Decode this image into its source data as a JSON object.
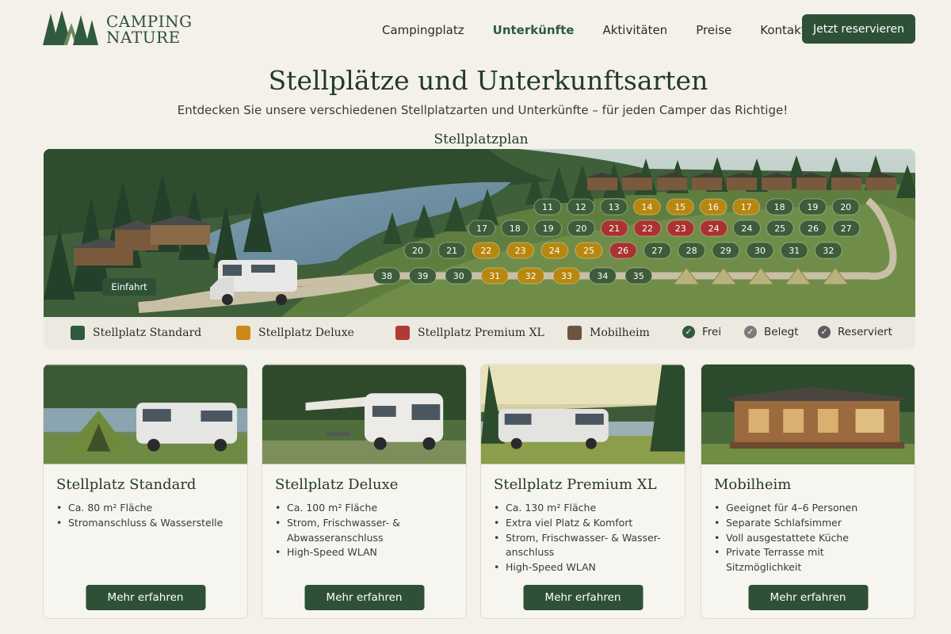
{
  "logo": {
    "line1": "CAMPING",
    "line2": "NATURE"
  },
  "nav": {
    "items": [
      {
        "label": "Campingplatz",
        "active": false
      },
      {
        "label": "Unterkünfte",
        "active": true
      },
      {
        "label": "Aktivitäten",
        "active": false
      },
      {
        "label": "Preise",
        "active": false
      },
      {
        "label": "Kontakt",
        "active": false
      }
    ],
    "cta": "Jetzt reservieren"
  },
  "hero": {
    "title": "Stellplätze und Unterkunftsarten",
    "subtitle": "Entdecken Sie unsere verschiedenen Stellplatzarten und Unterkünfte – für jeden Camper das Richtige!"
  },
  "plan": {
    "title": "Stellplatzplan",
    "entrance_label": "Einfahrt",
    "rows": [
      [
        "11",
        "12",
        "13",
        "14",
        "15",
        "16",
        "17",
        "18",
        "19",
        "20"
      ],
      [
        "17",
        "18",
        "19",
        "20",
        "21",
        "22",
        "23",
        "24",
        "24",
        "25",
        "26",
        "27"
      ],
      [
        "20",
        "21",
        "22",
        "23",
        "24",
        "25",
        "26",
        "27",
        "28",
        "29",
        "30",
        "31",
        "32"
      ],
      [
        "38",
        "39",
        "30",
        "31",
        "32",
        "33",
        "34",
        "35"
      ]
    ],
    "row_types": [
      [
        "standard",
        "standard",
        "standard",
        "deluxe",
        "deluxe",
        "deluxe",
        "deluxe",
        "standard",
        "standard",
        "standard"
      ],
      [
        "standard",
        "standard",
        "standard",
        "standard",
        "premium",
        "premium",
        "premium",
        "premium",
        "standard",
        "standard",
        "standard",
        "standard"
      ],
      [
        "standard",
        "standard",
        "deluxe",
        "deluxe",
        "deluxe",
        "deluxe",
        "premium",
        "standard",
        "standard",
        "standard",
        "standard",
        "standard",
        "standard"
      ],
      [
        "standard",
        "standard",
        "standard",
        "deluxe",
        "deluxe",
        "deluxe",
        "standard",
        "standard"
      ]
    ]
  },
  "legend": {
    "items": [
      {
        "label": "Stellplatz Standard",
        "color": "#2f5a3b"
      },
      {
        "label": "Stellplatz Deluxe",
        "color": "#c98a17"
      },
      {
        "label": "Stellplatz Premium XL",
        "color": "#b23a36"
      },
      {
        "label": "Mobilheim",
        "color": "#6b5540"
      }
    ],
    "status": [
      {
        "label": "Frei",
        "color": "#2f5a3b"
      },
      {
        "label": "Belegt",
        "color": "#7c7c7c"
      },
      {
        "label": "Reserviert",
        "color": "#5c5c5c"
      }
    ]
  },
  "cards": [
    {
      "title": "Stellplatz Standard",
      "features": [
        "Ca. 80 m² Fläche",
        "Stromanschluss & Wasserstelle"
      ],
      "button": "Mehr erfahren"
    },
    {
      "title": "Stellplatz Deluxe",
      "features": [
        "Ca. 100 m² Fläche",
        "Strom, Frischwasser- & Abwasseranschluss",
        "High-Speed WLAN"
      ],
      "button": "Mehr erfahren"
    },
    {
      "title": "Stellplatz Premium XL",
      "features": [
        "Ca. 130 m² Fläche",
        "Extra viel Platz & Komfort",
        "Strom, Frischwasser- & Wasser-anschluss",
        "High-Speed WLAN"
      ],
      "button": "Mehr erfahren"
    },
    {
      "title": "Mobilheim",
      "features": [
        "Geeignet für 4–6 Personen",
        "Separate Schlafsimmer",
        "Voll ausgestattete Küche",
        "Private Terrasse mit Sitzmöglichkeit"
      ],
      "button": "Mehr erfahren"
    }
  ],
  "colors": {
    "primary": "#2e5037",
    "background": "#f4f1ea",
    "standard": "#3e5c3a",
    "deluxe": "#b8870f",
    "premium": "#a93330"
  }
}
